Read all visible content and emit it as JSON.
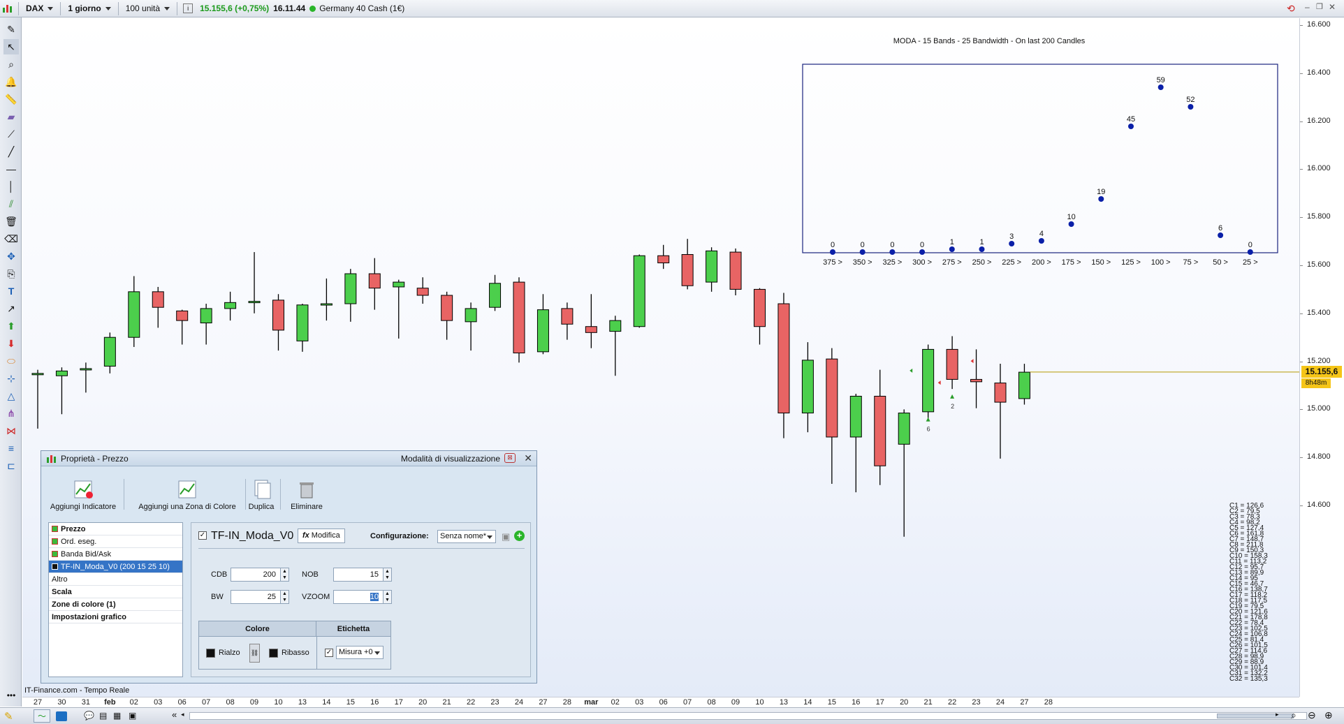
{
  "toolbar": {
    "instrument": "DAX",
    "timeframe": "1 giorno",
    "units": "100 unità",
    "price_change": "15.155,6 (+0,75%)",
    "time": "16.11.44",
    "market_name": "Germany 40 Cash (1€)"
  },
  "chart": {
    "footer_source": "IT-Finance.com - Tempo Reale",
    "current_price": "15.155,6",
    "countdown": "8h48m",
    "price_axis_labels": [
      "16.600",
      "16.400",
      "16.200",
      "16.000",
      "15.800",
      "15.600",
      "15.400",
      "15.200",
      "15.000",
      "14.800",
      "14.600"
    ],
    "date_labels": [
      "27",
      "30",
      "31",
      "feb",
      "02",
      "03",
      "06",
      "07",
      "08",
      "09",
      "10",
      "13",
      "14",
      "15",
      "16",
      "17",
      "20",
      "21",
      "22",
      "23",
      "24",
      "27",
      "28",
      "mar",
      "02",
      "03",
      "06",
      "07",
      "08",
      "09",
      "10",
      "13",
      "14",
      "15",
      "16",
      "17",
      "20",
      "21",
      "22",
      "23",
      "24",
      "27",
      "28"
    ],
    "candles": [
      {
        "o": 15150,
        "c": 15150,
        "h": 15165,
        "l": 14920
      },
      {
        "o": 15140,
        "c": 15160,
        "h": 15175,
        "l": 14980
      },
      {
        "o": 15170,
        "c": 15170,
        "h": 15195,
        "l": 15070
      },
      {
        "o": 15180,
        "c": 15300,
        "h": 15320,
        "l": 15150
      },
      {
        "o": 15300,
        "c": 15490,
        "h": 15555,
        "l": 15260
      },
      {
        "o": 15490,
        "c": 15425,
        "h": 15510,
        "l": 15340
      },
      {
        "o": 15410,
        "c": 15370,
        "h": 15415,
        "l": 15270
      },
      {
        "o": 15360,
        "c": 15420,
        "h": 15440,
        "l": 15270
      },
      {
        "o": 15420,
        "c": 15445,
        "h": 15490,
        "l": 15370
      },
      {
        "o": 15450,
        "c": 15450,
        "h": 15655,
        "l": 15400
      },
      {
        "o": 15455,
        "c": 15330,
        "h": 15480,
        "l": 15245
      },
      {
        "o": 15285,
        "c": 15435,
        "h": 15440,
        "l": 15240
      },
      {
        "o": 15440,
        "c": 15440,
        "h": 15545,
        "l": 15370
      },
      {
        "o": 15440,
        "c": 15565,
        "h": 15585,
        "l": 15365
      },
      {
        "o": 15565,
        "c": 15505,
        "h": 15630,
        "l": 15415
      },
      {
        "o": 15510,
        "c": 15530,
        "h": 15540,
        "l": 15295
      },
      {
        "o": 15505,
        "c": 15475,
        "h": 15550,
        "l": 15440
      },
      {
        "o": 15475,
        "c": 15370,
        "h": 15490,
        "l": 15290
      },
      {
        "o": 15365,
        "c": 15420,
        "h": 15445,
        "l": 15245
      },
      {
        "o": 15425,
        "c": 15525,
        "h": 15560,
        "l": 15410
      },
      {
        "o": 15530,
        "c": 15235,
        "h": 15550,
        "l": 15195
      },
      {
        "o": 15240,
        "c": 15415,
        "h": 15480,
        "l": 15230
      },
      {
        "o": 15420,
        "c": 15355,
        "h": 15445,
        "l": 15290
      },
      {
        "o": 15345,
        "c": 15320,
        "h": 15480,
        "l": 15255
      },
      {
        "o": 15325,
        "c": 15370,
        "h": 15390,
        "l": 15140
      },
      {
        "o": 15345,
        "c": 15640,
        "h": 15645,
        "l": 15340
      },
      {
        "o": 15640,
        "c": 15610,
        "h": 15685,
        "l": 15585
      },
      {
        "o": 15645,
        "c": 15515,
        "h": 15710,
        "l": 15500
      },
      {
        "o": 15530,
        "c": 15660,
        "h": 15675,
        "l": 15490
      },
      {
        "o": 15655,
        "c": 15500,
        "h": 15670,
        "l": 15475
      },
      {
        "o": 15500,
        "c": 15345,
        "h": 15505,
        "l": 15270
      },
      {
        "o": 15440,
        "c": 14985,
        "h": 15485,
        "l": 14880
      },
      {
        "o": 14985,
        "c": 15205,
        "h": 15280,
        "l": 14905
      },
      {
        "o": 15210,
        "c": 14885,
        "h": 15255,
        "l": 14690
      },
      {
        "o": 14885,
        "c": 15055,
        "h": 15065,
        "l": 14655
      },
      {
        "o": 15055,
        "c": 14765,
        "h": 15165,
        "l": 14685
      },
      {
        "o": 14855,
        "c": 14985,
        "h": 15000,
        "l": 14470
      },
      {
        "o": 14990,
        "c": 15250,
        "h": 15270,
        "l": 14950
      },
      {
        "o": 15250,
        "c": 15125,
        "h": 15305,
        "l": 15085
      },
      {
        "o": 15125,
        "c": 15115,
        "h": 15250,
        "l": 15005
      },
      {
        "o": 15110,
        "c": 15030,
        "h": 15190,
        "l": 14795
      },
      {
        "o": 15045,
        "c": 15155,
        "h": 15190,
        "l": 15020
      }
    ],
    "markers": [
      {
        "label": "6"
      },
      {
        "label": "2"
      }
    ],
    "c_values": [
      "C1 = 126,6",
      "C2 = 79,5",
      "C3 = 78,3",
      "C4 = 98,2",
      "C5 = 127,4",
      "C6 = 161,8",
      "C7 = 148,7",
      "C8 = 211,8",
      "C9 = 150,3",
      "C10 = 158,3",
      "C11 = 113,2",
      "C12 = 95,7",
      "C13 = 89,9",
      "C14 = 95",
      "C15 = 46,7",
      "C16 = 138,7",
      "C17 = 118,2",
      "C18 = 117,5",
      "C19 = 79,5",
      "C20 = 121,6",
      "C21 = 178,8",
      "C22 = 78,4",
      "C23 = 102,5",
      "C24 = 106,8",
      "C25 = 81,4",
      "C26 = 101,5",
      "C27 = 114,6",
      "C28 = 98,9",
      "C29 = 88,9",
      "C30 = 101,4",
      "C31 = 132,2",
      "C32 = 135,3"
    ]
  },
  "moda_chart": {
    "title": "MODA - 15 Bands - 25 Bandwidth - On last 200 Candles",
    "chart_data": {
      "type": "scatter",
      "title": "MODA - 15 Bands - 25 Bandwidth - On last 200 Candles",
      "categories": [
        "375 >",
        "350 >",
        "325 >",
        "300 >",
        "275 >",
        "250 >",
        "225 >",
        "200 >",
        "175 >",
        "150 >",
        "125 >",
        "100 >",
        "75 >",
        "50 >",
        "25 >"
      ],
      "values": [
        0,
        0,
        0,
        0,
        1,
        1,
        3,
        4,
        10,
        19,
        45,
        59,
        52,
        6,
        0
      ],
      "ylim": [
        0,
        60
      ]
    }
  },
  "panel": {
    "title": "Proprietà - Prezzo",
    "mode_label": "Modalità di visualizzazione",
    "buttons": [
      "Aggiungi Indicatore",
      "Aggiungi una Zona di Colore",
      "Duplica",
      "Eliminare"
    ],
    "list_items": [
      {
        "label": "Prezzo",
        "swatch": "#3cba3c",
        "bold": true
      },
      {
        "label": "Ord. eseg.",
        "swatch": "#3cba3c",
        "bold": false
      },
      {
        "label": "Banda Bid/Ask",
        "swatch": "#3cba3c",
        "bold": false
      },
      {
        "label": "TF-IN_Moda_V0 (200 15 25 10)",
        "swatch": "#111111",
        "bold": false,
        "selected": true
      },
      {
        "label": "Altro",
        "bold": false
      },
      {
        "label": "Scala",
        "bold": true
      },
      {
        "label": "Zone di colore (1)",
        "bold": true
      },
      {
        "label": "Impostazioni grafico",
        "bold": true
      }
    ],
    "indicator_name": "TF-IN_Moda_V0",
    "modify_label": "Modifica",
    "config_label": "Configurazione:",
    "config_value": "Senza nome*",
    "params": {
      "cdb_label": "CDB",
      "cdb_value": "200",
      "nob_label": "NOB",
      "nob_value": "15",
      "bw_label": "BW",
      "bw_value": "25",
      "vzoom_label": "VZOOM",
      "vzoom_value": "10"
    },
    "color_header": "Colore",
    "label_header": "Etichetta",
    "rialzo": "Rialzo",
    "ribasso": "Ribasso",
    "measure": "Misura +0"
  },
  "colors": {
    "up": "#4ccf4c",
    "down": "#e86464",
    "moda_dot": "#0a1fa8",
    "price_tag": "#f5c518"
  }
}
